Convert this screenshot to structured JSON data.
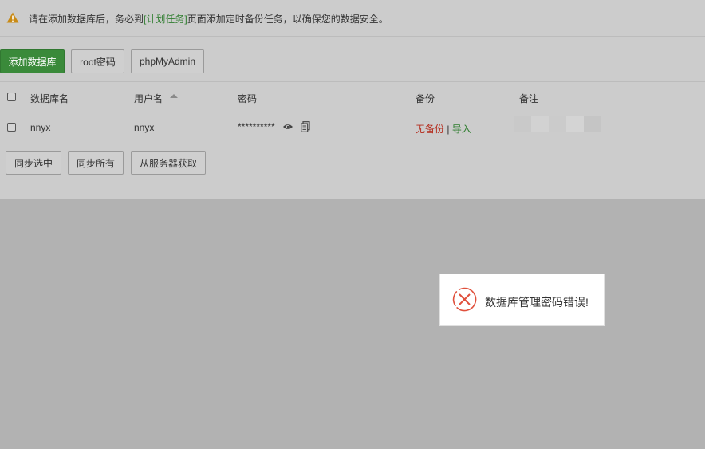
{
  "notice": {
    "icon": "warning-icon",
    "text_before": "请在添加数据库后，务必到",
    "link": "[计划任务]",
    "text_after": "页面添加定时备份任务，以确保您的数据安全。"
  },
  "toolbar": {
    "add_db": "添加数据库",
    "root_pwd": "root密码",
    "phpmyadmin": "phpMyAdmin"
  },
  "table": {
    "columns": {
      "db_name": "数据库名",
      "username": "用户名",
      "password": "密码",
      "backup": "备份",
      "note": "备注"
    },
    "rows": [
      {
        "db_name": "nnyx",
        "username": "nnyx",
        "password": "**********",
        "backup_status": "无备份",
        "separator": "|",
        "import": "导入"
      }
    ]
  },
  "bottom": {
    "sync_selected": "同步选中",
    "sync_all": "同步所有",
    "fetch_server": "从服务器获取"
  },
  "dialog": {
    "icon": "error-icon",
    "message": "数据库管理密码错误!"
  },
  "colors": {
    "accent_green": "#3a8a3a",
    "link_green": "#2e7d2e",
    "error_red": "#e0503c",
    "backup_red": "#b42b1c"
  }
}
